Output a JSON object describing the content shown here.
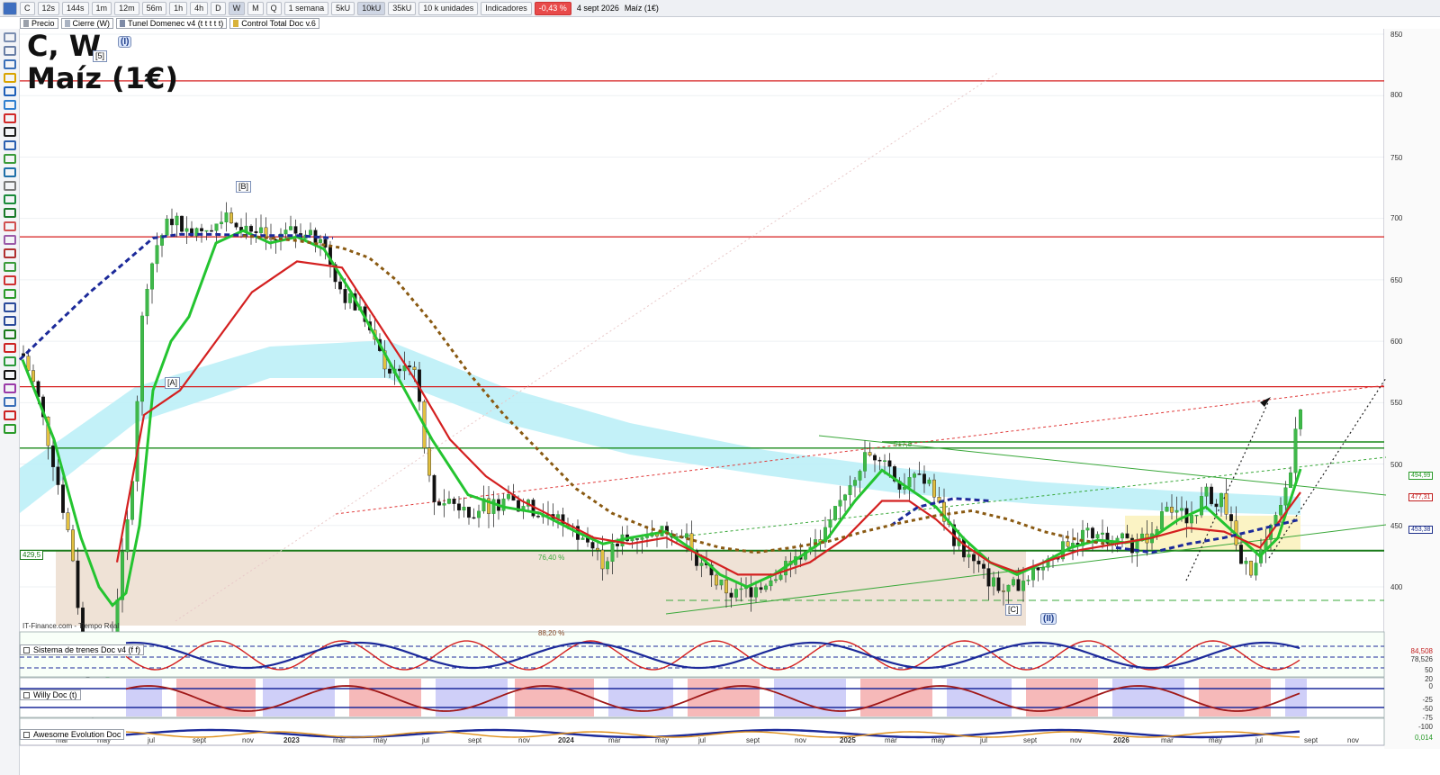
{
  "toolbar": {
    "symbol": "C",
    "intervals": [
      "12s",
      "144s",
      "1m",
      "12m",
      "56m",
      "1h",
      "4h",
      "D",
      "W",
      "M",
      "Q"
    ],
    "active_interval": "W",
    "period": "1 semana",
    "units": [
      "5kU",
      "10kU",
      "35kU"
    ],
    "active_unit": "10kU",
    "unit_select": "10 k unidades",
    "indicators_label": "Indicadores",
    "change": "-0,43 %",
    "date": "4 sept 2026",
    "instrument": "Maíz (1€)"
  },
  "tags": [
    {
      "label": "Precio",
      "color": "#9aa0aa"
    },
    {
      "label": "Cierre (W)",
      "color": "#aab3c2"
    },
    {
      "label": "Tunel Domenec v4 (t t t t t)",
      "color": "#7d8aa6"
    },
    {
      "label": "Control Total Doc v.6",
      "color": "#d8b23a"
    }
  ],
  "chart": {
    "title_line1": "C, W",
    "title_line2": "Maíz (1€)",
    "source": "IT-Finance.com - Tiempo Real",
    "waves": [
      {
        "label": "[5]",
        "x": 103,
        "y": 56
      },
      {
        "label": "(I)",
        "x": 131,
        "y": 40,
        "circle": true
      },
      {
        "label": "[B]",
        "x": 262,
        "y": 201
      },
      {
        "label": "[A]",
        "x": 183,
        "y": 419
      },
      {
        "label": "[C]",
        "x": 1117,
        "y": 671
      },
      {
        "label": "(II)",
        "x": 1156,
        "y": 681,
        "circle": true
      }
    ],
    "price_labels": [
      "494,99",
      "477,31",
      "453,38"
    ],
    "left_box_label": "429,5",
    "level_label": "517,8",
    "fib_labels": [
      "76,40 %",
      "88,20 %"
    ],
    "y_ticks": [
      "850",
      "800",
      "750",
      "700",
      "650",
      "600",
      "550",
      "500",
      "450",
      "400"
    ],
    "x_labels": [
      "mar",
      "may",
      "jul",
      "sept",
      "nov",
      "2023",
      "mar",
      "may",
      "jul",
      "sept",
      "nov",
      "2024",
      "mar",
      "may",
      "jul",
      "sept",
      "nov",
      "2025",
      "mar",
      "may",
      "jul",
      "sept",
      "nov",
      "2026",
      "mar",
      "may",
      "jul",
      "sept",
      "nov"
    ]
  },
  "subpanels": [
    {
      "name": "Sistema de trenes Doc v4 (f f)",
      "values": [
        "84,508",
        "78,526",
        "50",
        "20",
        "0"
      ]
    },
    {
      "name": "Willy Doc (t)",
      "values": [
        "-25",
        "-50",
        "-75",
        "-100"
      ]
    },
    {
      "name": "Awesome Evolution Doc",
      "values": [
        "0,014"
      ]
    }
  ]
}
